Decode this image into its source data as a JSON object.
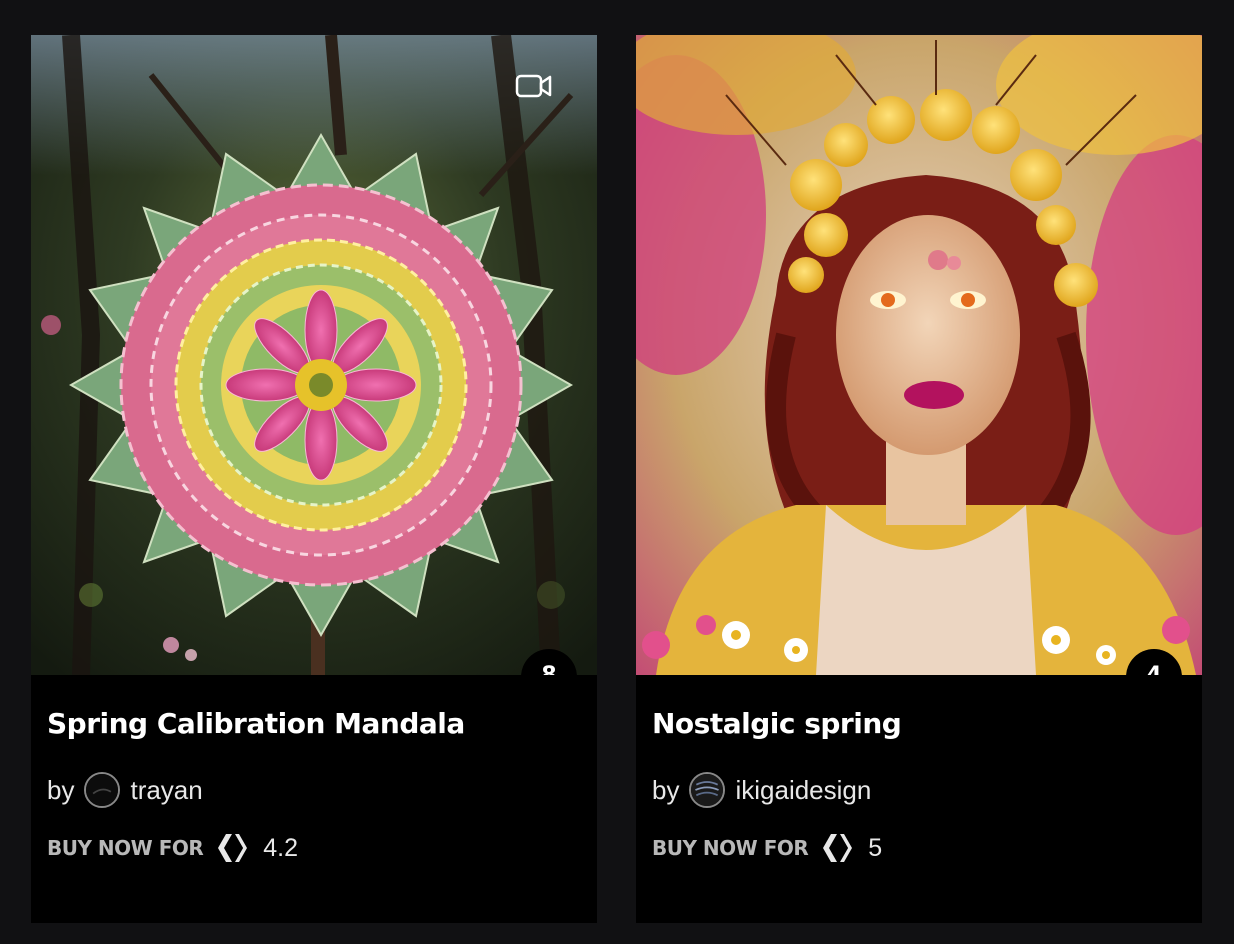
{
  "cards": [
    {
      "title": "Spring Calibration Mandala",
      "by_label": "by",
      "author": "trayan",
      "buy_label": "BUY NOW FOR",
      "price": "4.2",
      "edition_count": "8",
      "media_type": "video-icon"
    },
    {
      "title": "Nostalgic spring",
      "by_label": "by",
      "author": "ikigaidesign",
      "buy_label": "BUY NOW FOR",
      "price": "5",
      "edition_count": "4"
    }
  ],
  "colors": {
    "page_bg": "#111113",
    "card_bg": "#000000",
    "text_primary": "#ffffff",
    "text_secondary": "#b8b8b8"
  }
}
